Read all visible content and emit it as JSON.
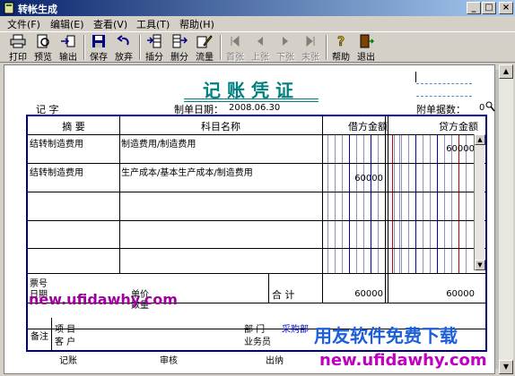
{
  "window": {
    "title": "转帐生成",
    "min": "_",
    "max": "□",
    "close": "×"
  },
  "menu": [
    "文件(F)",
    "编辑(E)",
    "查看(V)",
    "工具(T)",
    "帮助(H)"
  ],
  "toolbar": {
    "print": "打印",
    "preview": "预览",
    "export": "输出",
    "save": "保存",
    "discard": "放弃",
    "insert": "插分",
    "delete": "删分",
    "flow": "流量",
    "first": "首张",
    "prev": "上张",
    "next": "下张",
    "last": "末张",
    "help": "帮助",
    "exit": "退出"
  },
  "voucher": {
    "title": "记账凭证",
    "type_label": "记 字",
    "date_label": "制单日期：",
    "date": "2008.06.30",
    "attach_label": "附单据数：",
    "attach_count": "0",
    "headers": {
      "summary": "摘 要",
      "subject": "科目名称",
      "debit": "借方金额",
      "credit": "贷方金额"
    },
    "rows": [
      {
        "summary": "结转制造费用",
        "subject": "制造费用/制造费用",
        "debit": "",
        "credit": "60000"
      },
      {
        "summary": "结转制造费用",
        "subject": "生产成本/基本生产成本/制造费用",
        "debit": "60000",
        "credit": ""
      },
      {
        "summary": "",
        "subject": "",
        "debit": "",
        "credit": ""
      },
      {
        "summary": "",
        "subject": "",
        "debit": "",
        "credit": ""
      },
      {
        "summary": "",
        "subject": "",
        "debit": "",
        "credit": ""
      }
    ],
    "footer": {
      "ticket": "票号",
      "date": "日期",
      "price": "单价",
      "qty": "数量",
      "total_label": "合 计",
      "total_debit": "60000",
      "total_credit": "60000"
    },
    "notes": {
      "label": "备注",
      "project": "项  目",
      "customer": "客  户",
      "dept": "部  门",
      "dept_value": "采购部",
      "staff": "业务员"
    },
    "signers": [
      "记账",
      "审核",
      "出纳"
    ]
  },
  "watermark": {
    "url1": "new.ufidawhy.com",
    "slogan": "用友软件免费下载",
    "url2": "new.ufidawhy.com"
  },
  "colors": {
    "title_teal": "#008080",
    "grid_blue": "#000080",
    "wm_url": "#a000a0",
    "wm_slogan": "#1c5fd8"
  }
}
